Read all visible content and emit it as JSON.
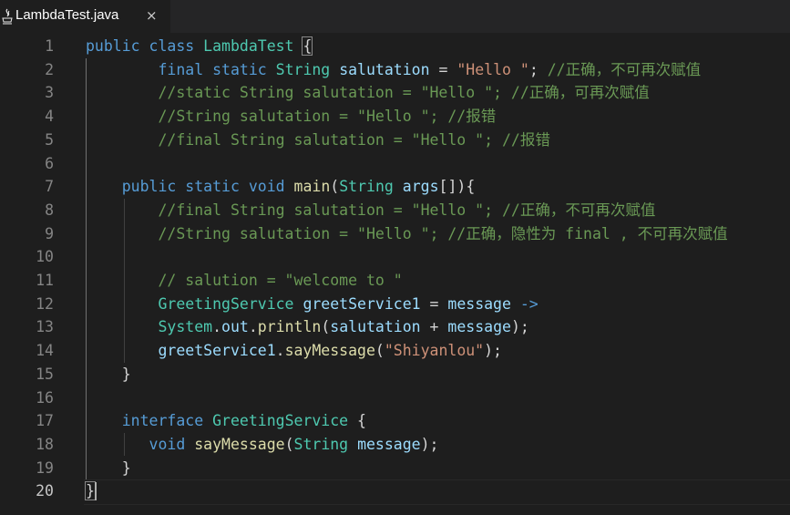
{
  "tab": {
    "title": "LambdaTest.java",
    "close_glyph": "×",
    "icon": "java-file-icon"
  },
  "colors": {
    "keyword": "#569cd6",
    "type": "#4ec9b0",
    "variable": "#9cdcfe",
    "function": "#dcdcaa",
    "string": "#ce9178",
    "comment": "#6a9955",
    "plain": "#d4d4d4",
    "background": "#1e1e1e"
  },
  "editor": {
    "active_line": 20,
    "lines": [
      {
        "n": "1",
        "tokens": [
          [
            "kw",
            "public"
          ],
          [
            "pu",
            " "
          ],
          [
            "kw",
            "class"
          ],
          [
            "pu",
            " "
          ],
          [
            "ty",
            "LambdaTest"
          ],
          [
            "pu",
            " "
          ],
          [
            "br",
            "{"
          ]
        ]
      },
      {
        "n": "2",
        "tokens": [
          [
            "pu",
            "        "
          ],
          [
            "kw",
            "final"
          ],
          [
            "pu",
            " "
          ],
          [
            "kw",
            "static"
          ],
          [
            "pu",
            " "
          ],
          [
            "ty",
            "String"
          ],
          [
            "pu",
            " "
          ],
          [
            "va",
            "salutation"
          ],
          [
            "pu",
            " = "
          ],
          [
            "st",
            "\"Hello \""
          ],
          [
            "pu",
            "; "
          ],
          [
            "cm",
            "//正确，不可再次赋值"
          ]
        ]
      },
      {
        "n": "3",
        "tokens": [
          [
            "pu",
            "        "
          ],
          [
            "cm",
            "//static String salutation = \"Hello \"; //正确，可再次赋值"
          ]
        ]
      },
      {
        "n": "4",
        "tokens": [
          [
            "pu",
            "        "
          ],
          [
            "cm",
            "//String salutation = \"Hello \"; //报错"
          ]
        ]
      },
      {
        "n": "5",
        "tokens": [
          [
            "pu",
            "        "
          ],
          [
            "cm",
            "//final String salutation = \"Hello \"; //报错"
          ]
        ]
      },
      {
        "n": "6",
        "tokens": []
      },
      {
        "n": "7",
        "tokens": [
          [
            "pu",
            "    "
          ],
          [
            "kw",
            "public"
          ],
          [
            "pu",
            " "
          ],
          [
            "kw",
            "static"
          ],
          [
            "pu",
            " "
          ],
          [
            "kw",
            "void"
          ],
          [
            "pu",
            " "
          ],
          [
            "fn",
            "main"
          ],
          [
            "pu",
            "("
          ],
          [
            "ty",
            "String"
          ],
          [
            "pu",
            " "
          ],
          [
            "va",
            "args"
          ],
          [
            "pu",
            "[]){"
          ]
        ]
      },
      {
        "n": "8",
        "tokens": [
          [
            "pu",
            "        "
          ],
          [
            "cm",
            "//final String salutation = \"Hello \"; //正确，不可再次赋值"
          ]
        ]
      },
      {
        "n": "9",
        "tokens": [
          [
            "pu",
            "        "
          ],
          [
            "cm",
            "//String salutation = \"Hello \"; //正确，隐性为 final , 不可再次赋值"
          ]
        ]
      },
      {
        "n": "10",
        "tokens": []
      },
      {
        "n": "11",
        "tokens": [
          [
            "pu",
            "        "
          ],
          [
            "cm",
            "// salution = \"welcome to \""
          ]
        ]
      },
      {
        "n": "12",
        "tokens": [
          [
            "pu",
            "        "
          ],
          [
            "ty",
            "GreetingService"
          ],
          [
            "pu",
            " "
          ],
          [
            "va",
            "greetService1"
          ],
          [
            "pu",
            " = "
          ],
          [
            "va",
            "message"
          ],
          [
            "pu",
            " "
          ],
          [
            "kw",
            "->"
          ]
        ]
      },
      {
        "n": "13",
        "tokens": [
          [
            "pu",
            "        "
          ],
          [
            "ty",
            "System"
          ],
          [
            "pu",
            "."
          ],
          [
            "va",
            "out"
          ],
          [
            "pu",
            "."
          ],
          [
            "fn",
            "println"
          ],
          [
            "pu",
            "("
          ],
          [
            "va",
            "salutation"
          ],
          [
            "pu",
            " + "
          ],
          [
            "va",
            "message"
          ],
          [
            "pu",
            ");"
          ]
        ]
      },
      {
        "n": "14",
        "tokens": [
          [
            "pu",
            "        "
          ],
          [
            "va",
            "greetService1"
          ],
          [
            "pu",
            "."
          ],
          [
            "fn",
            "sayMessage"
          ],
          [
            "pu",
            "("
          ],
          [
            "st",
            "\"Shiyanlou\""
          ],
          [
            "pu",
            ");"
          ]
        ]
      },
      {
        "n": "15",
        "tokens": [
          [
            "pu",
            "    }"
          ]
        ]
      },
      {
        "n": "16",
        "tokens": []
      },
      {
        "n": "17",
        "tokens": [
          [
            "pu",
            "    "
          ],
          [
            "kw",
            "interface"
          ],
          [
            "pu",
            " "
          ],
          [
            "ty",
            "GreetingService"
          ],
          [
            "pu",
            " {"
          ]
        ]
      },
      {
        "n": "18",
        "tokens": [
          [
            "pu",
            "       "
          ],
          [
            "kw",
            "void"
          ],
          [
            "pu",
            " "
          ],
          [
            "fn",
            "sayMessage"
          ],
          [
            "pu",
            "("
          ],
          [
            "ty",
            "String"
          ],
          [
            "pu",
            " "
          ],
          [
            "va",
            "message"
          ],
          [
            "pu",
            ");"
          ]
        ]
      },
      {
        "n": "19",
        "tokens": [
          [
            "pu",
            "    }"
          ]
        ]
      },
      {
        "n": "20",
        "tokens": [
          [
            "br",
            "}"
          ]
        ]
      }
    ]
  }
}
